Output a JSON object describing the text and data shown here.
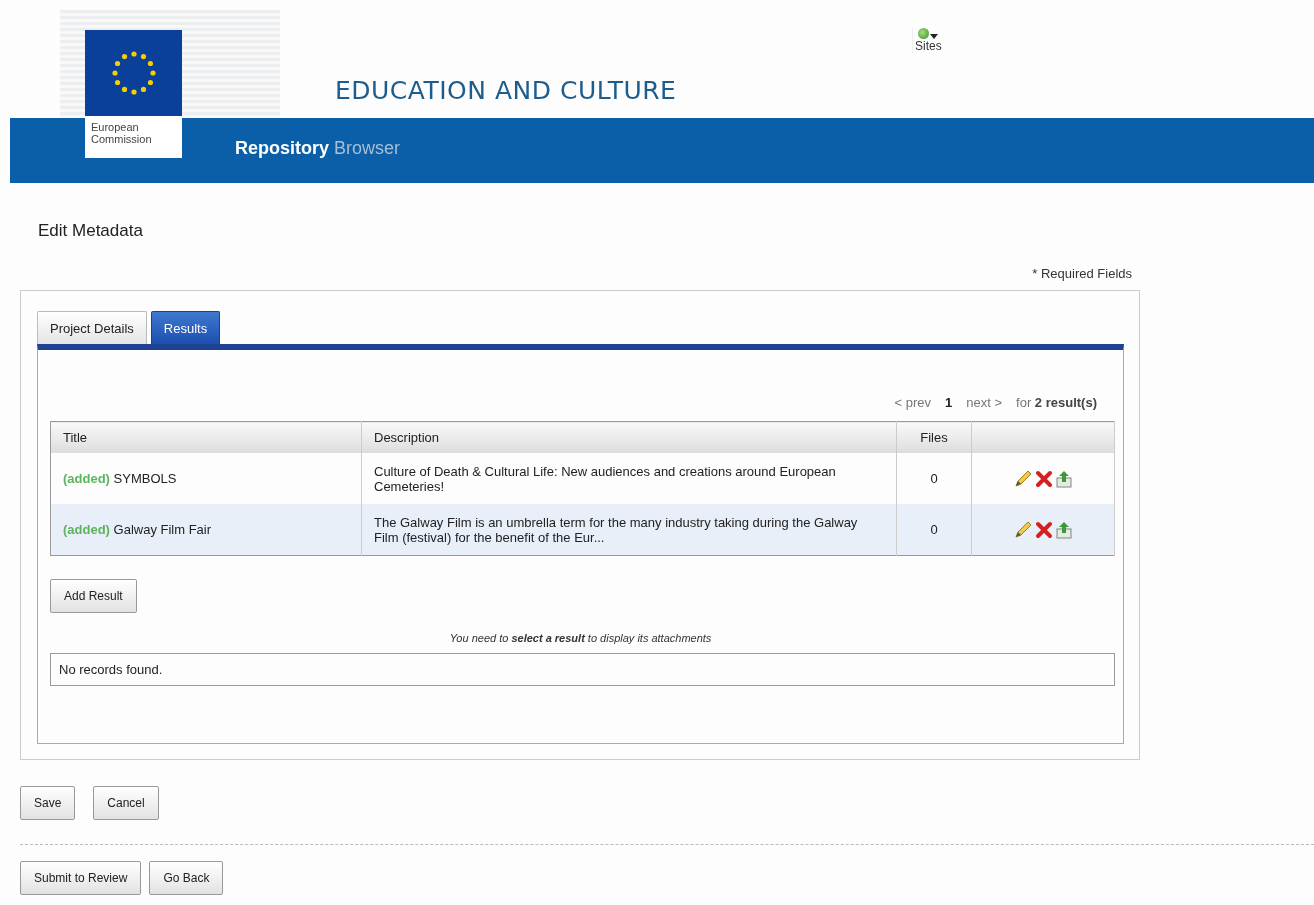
{
  "header": {
    "logo_lines": [
      "European",
      "Commission"
    ],
    "site_title": "EDUCATION AND CULTURE",
    "sites_menu": "Sites",
    "app_name_primary": "Repository",
    "app_name_secondary": "Browser"
  },
  "page_title": "Edit Metadata",
  "required_note": "* Required Fields",
  "tabs": [
    {
      "label": "Project Details",
      "selected": false
    },
    {
      "label": "Results",
      "selected": true
    }
  ],
  "pager": {
    "prev": "< prev",
    "current": "1",
    "next": "next >",
    "summary": "for **2 result(s)**"
  },
  "table": {
    "columns": [
      "Title",
      "Description",
      "Files"
    ],
    "rows": [
      {
        "status": "(added)",
        "title": "SYMBOLS",
        "description": "Culture of Death & Cultural Life: New audiences and creations around European Cemeteries!",
        "files": "0"
      },
      {
        "status": "(added)",
        "title": "Galway Film Fair",
        "description": "The Galway Film is an umbrella term for the many industry taking during the Galway Film (festival) for the benefit of the Eur...",
        "files": "0"
      }
    ]
  },
  "add_button": "Add Result",
  "attachments_hint": "You need to **select a result** to display its attachments",
  "attachments_empty": "No records found.",
  "form_buttons": [
    "Save",
    "Cancel"
  ],
  "footer_buttons": [
    "Submit to Review",
    "Go Back"
  ]
}
